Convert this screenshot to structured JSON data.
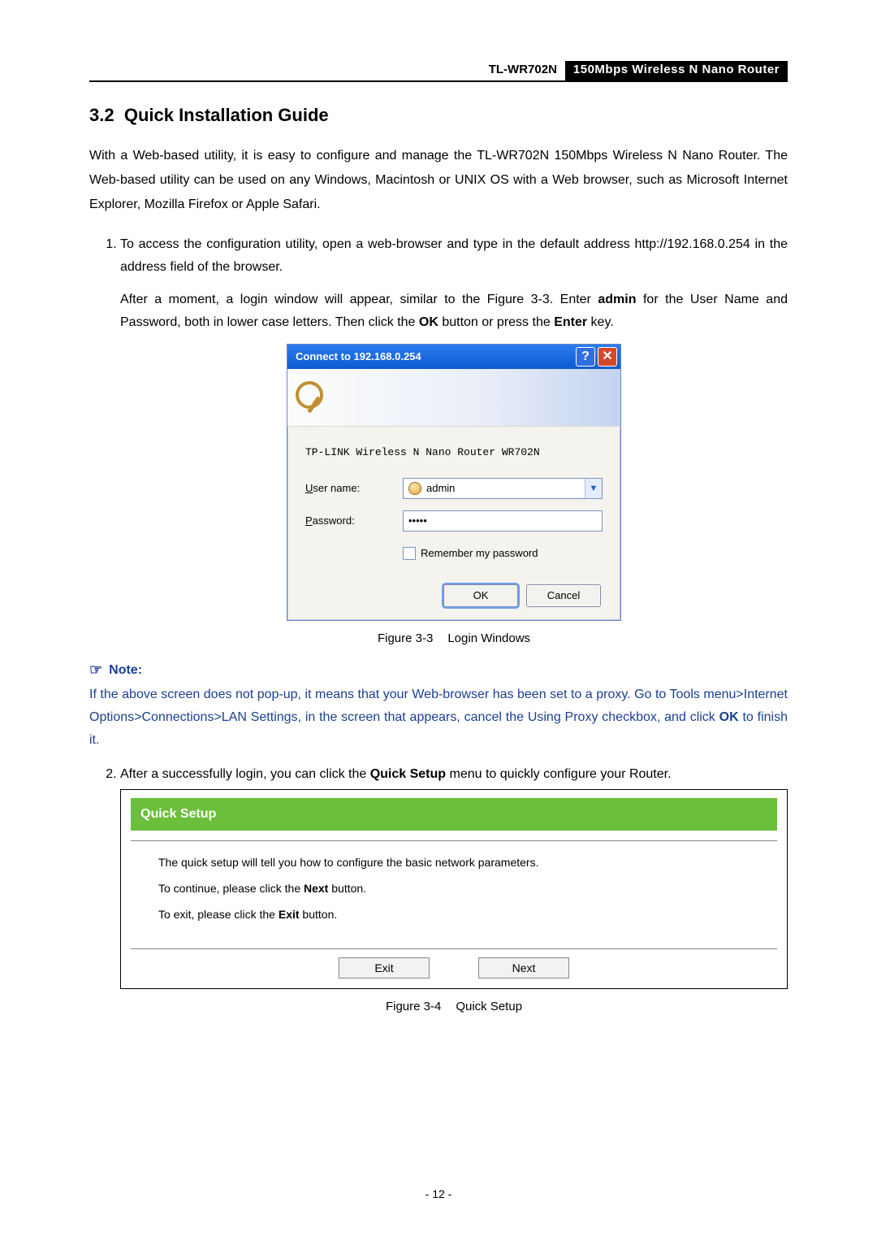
{
  "header": {
    "model": "TL-WR702N",
    "product": "150Mbps Wireless N Nano Router"
  },
  "section": {
    "number": "3.2",
    "title": "Quick Installation Guide"
  },
  "intro": "With a Web-based utility, it is easy to configure and manage the TL-WR702N 150Mbps Wireless N Nano Router. The Web-based utility can be used on any Windows, Macintosh or UNIX OS with a Web browser, such as Microsoft Internet Explorer, Mozilla Firefox or Apple Safari.",
  "step1": {
    "p1": "To access the configuration utility, open a web-browser and type in the default address http://192.168.0.254 in the address field of the browser.",
    "p2a": "After a moment, a login window will appear, similar to the Figure 3-3. Enter ",
    "p2b": "admin",
    "p2c": " for the User Name and Password, both in lower case letters. Then click the ",
    "p2d": "OK",
    "p2e": " button or press the ",
    "p2f": "Enter",
    "p2g": " key."
  },
  "login": {
    "title": "Connect to 192.168.0.254",
    "realm": "TP-LINK Wireless N Nano Router WR702N",
    "user_label": "ser name:",
    "user_ul": "U",
    "pass_label": "assword:",
    "pass_ul": "P",
    "user_value": "admin",
    "pass_value": "•••••",
    "remember_ul": "R",
    "remember": "emember my password",
    "ok": "OK",
    "cancel": "Cancel"
  },
  "fig33": {
    "num": "Figure 3-3",
    "title": "Login Windows"
  },
  "note": {
    "lead": "Note:",
    "body_a": "If the above screen does not pop-up, it means that your Web-browser has been set to a proxy. Go to Tools menu>Internet Options>Connections>LAN Settings, in the screen that appears, cancel the Using Proxy checkbox, and click ",
    "body_b": "OK",
    "body_c": " to finish it."
  },
  "step2": {
    "a": "After a successfully login, you can click the ",
    "b": "Quick Setup",
    "c": " menu to quickly configure your Router."
  },
  "quicksetup": {
    "title": "Quick Setup",
    "line1": "The quick setup will tell you how to configure the basic network parameters.",
    "line2a": "To continue, please click the ",
    "line2b": "Next",
    "line2c": " button.",
    "line3a": "To exit, please click the ",
    "line3b": "Exit",
    "line3c": " button.",
    "exit": "Exit",
    "next": "Next"
  },
  "fig34": {
    "num": "Figure 3-4",
    "title": "Quick Setup"
  },
  "pagenum": "- 12 -"
}
